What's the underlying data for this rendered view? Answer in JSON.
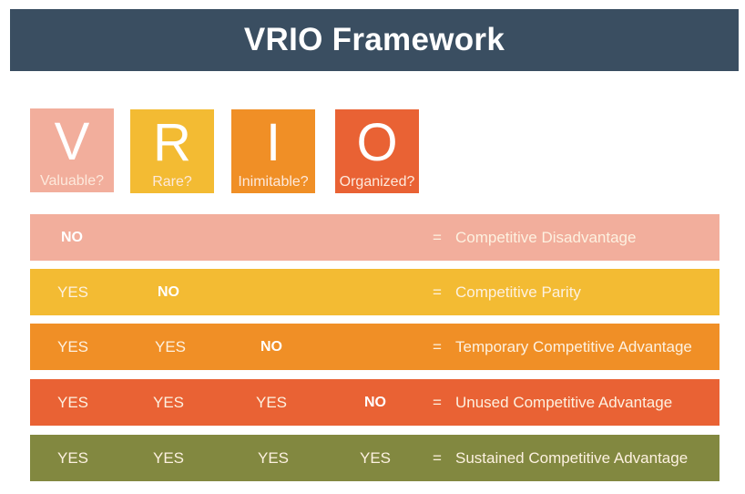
{
  "title": "VRIO Framework",
  "colors": {
    "title_bg": "#3a4e61",
    "valuable": "#f2ae9c",
    "rare": "#f3bb33",
    "inimitable": "#f08f26",
    "organized": "#e96234",
    "sustained": "#828840"
  },
  "criteria": [
    {
      "letter": "V",
      "question": "Valuable?"
    },
    {
      "letter": "R",
      "question": "Rare?"
    },
    {
      "letter": "I",
      "question": "Inimitable?"
    },
    {
      "letter": "O",
      "question": "Organized?"
    }
  ],
  "rows": [
    {
      "answers": [
        "NO"
      ],
      "equals": "=",
      "result": "Competitive Disadvantage"
    },
    {
      "answers": [
        "YES",
        "NO"
      ],
      "equals": "=",
      "result": "Competitive Parity"
    },
    {
      "answers": [
        "YES",
        "YES",
        "NO"
      ],
      "equals": "=",
      "result": "Temporary Competitive Advantage"
    },
    {
      "answers": [
        "YES",
        "YES",
        "YES",
        "NO"
      ],
      "equals": "=",
      "result": "Unused Competitive Advantage"
    },
    {
      "answers": [
        "YES",
        "YES",
        "YES",
        "YES"
      ],
      "equals": "=",
      "result": "Sustained Competitive Advantage"
    }
  ]
}
